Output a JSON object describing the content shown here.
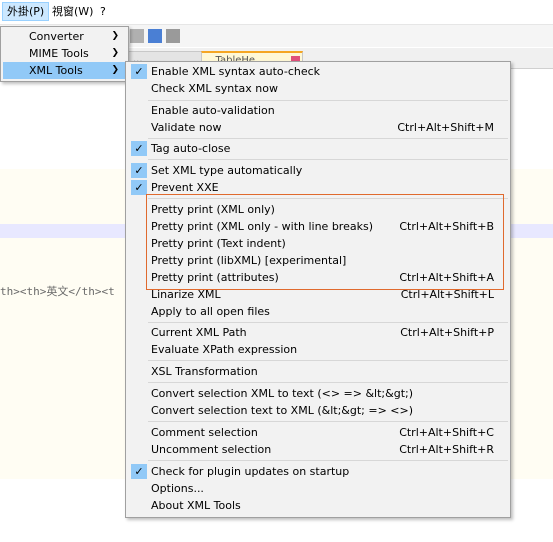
{
  "menubar": {
    "items": [
      {
        "label": "外掛(P)"
      },
      {
        "label": "視窗(W)"
      },
      {
        "label": "?"
      }
    ]
  },
  "tabs": [
    {
      "label": "..."
    },
    {
      "label": "...TableHe..."
    }
  ],
  "editor": {
    "code_line": "th><th>英文</th><t"
  },
  "plugins_menu": {
    "items": [
      {
        "label": "Converter"
      },
      {
        "label": "MIME Tools"
      },
      {
        "label": "XML Tools"
      }
    ]
  },
  "xml_tools_menu": {
    "items": [
      {
        "label": "Enable XML syntax auto-check",
        "shortcut": "",
        "checked": true
      },
      {
        "label": "Check XML syntax now",
        "shortcut": "",
        "checked": false
      },
      {
        "label": "Enable auto-validation",
        "shortcut": "",
        "checked": false
      },
      {
        "label": "Validate now",
        "shortcut": "Ctrl+Alt+Shift+M",
        "checked": false
      },
      {
        "label": "Tag auto-close",
        "shortcut": "",
        "checked": true
      },
      {
        "label": "Set XML type automatically",
        "shortcut": "",
        "checked": true
      },
      {
        "label": "Prevent XXE",
        "shortcut": "",
        "checked": true
      },
      {
        "label": "Pretty print (XML only)",
        "shortcut": "",
        "checked": false
      },
      {
        "label": "Pretty print (XML only - with line breaks)",
        "shortcut": "Ctrl+Alt+Shift+B",
        "checked": false
      },
      {
        "label": "Pretty print (Text indent)",
        "shortcut": "",
        "checked": false
      },
      {
        "label": "Pretty print (libXML) [experimental]",
        "shortcut": "",
        "checked": false
      },
      {
        "label": "Pretty print (attributes)",
        "shortcut": "Ctrl+Alt+Shift+A",
        "checked": false
      },
      {
        "label": "Linarize XML",
        "shortcut": "Ctrl+Alt+Shift+L",
        "checked": false
      },
      {
        "label": "Apply to all open files",
        "shortcut": "",
        "checked": false
      },
      {
        "label": "Current XML Path",
        "shortcut": "Ctrl+Alt+Shift+P",
        "checked": false
      },
      {
        "label": "Evaluate XPath expression",
        "shortcut": "",
        "checked": false
      },
      {
        "label": "XSL Transformation",
        "shortcut": "",
        "checked": false
      },
      {
        "label": "Convert selection XML to text (<> => &lt;&gt;)",
        "shortcut": "",
        "checked": false
      },
      {
        "label": "Convert selection text to XML (&lt;&gt; => <>)",
        "shortcut": "",
        "checked": false
      },
      {
        "label": "Comment selection",
        "shortcut": "Ctrl+Alt+Shift+C",
        "checked": false
      },
      {
        "label": "Uncomment selection",
        "shortcut": "Ctrl+Alt+Shift+R",
        "checked": false
      },
      {
        "label": "Check for plugin updates on startup",
        "shortcut": "",
        "checked": true
      },
      {
        "label": "Options...",
        "shortcut": "",
        "checked": false
      },
      {
        "label": "About XML Tools",
        "shortcut": "",
        "checked": false
      }
    ]
  },
  "colors": {
    "menu_bg": "#f2f2f2",
    "highlight": "#91c9f7",
    "annotation_box": "#e06a2e"
  },
  "icons": {
    "check": "check-icon",
    "submenu_arrow": "chevron-right-icon"
  }
}
